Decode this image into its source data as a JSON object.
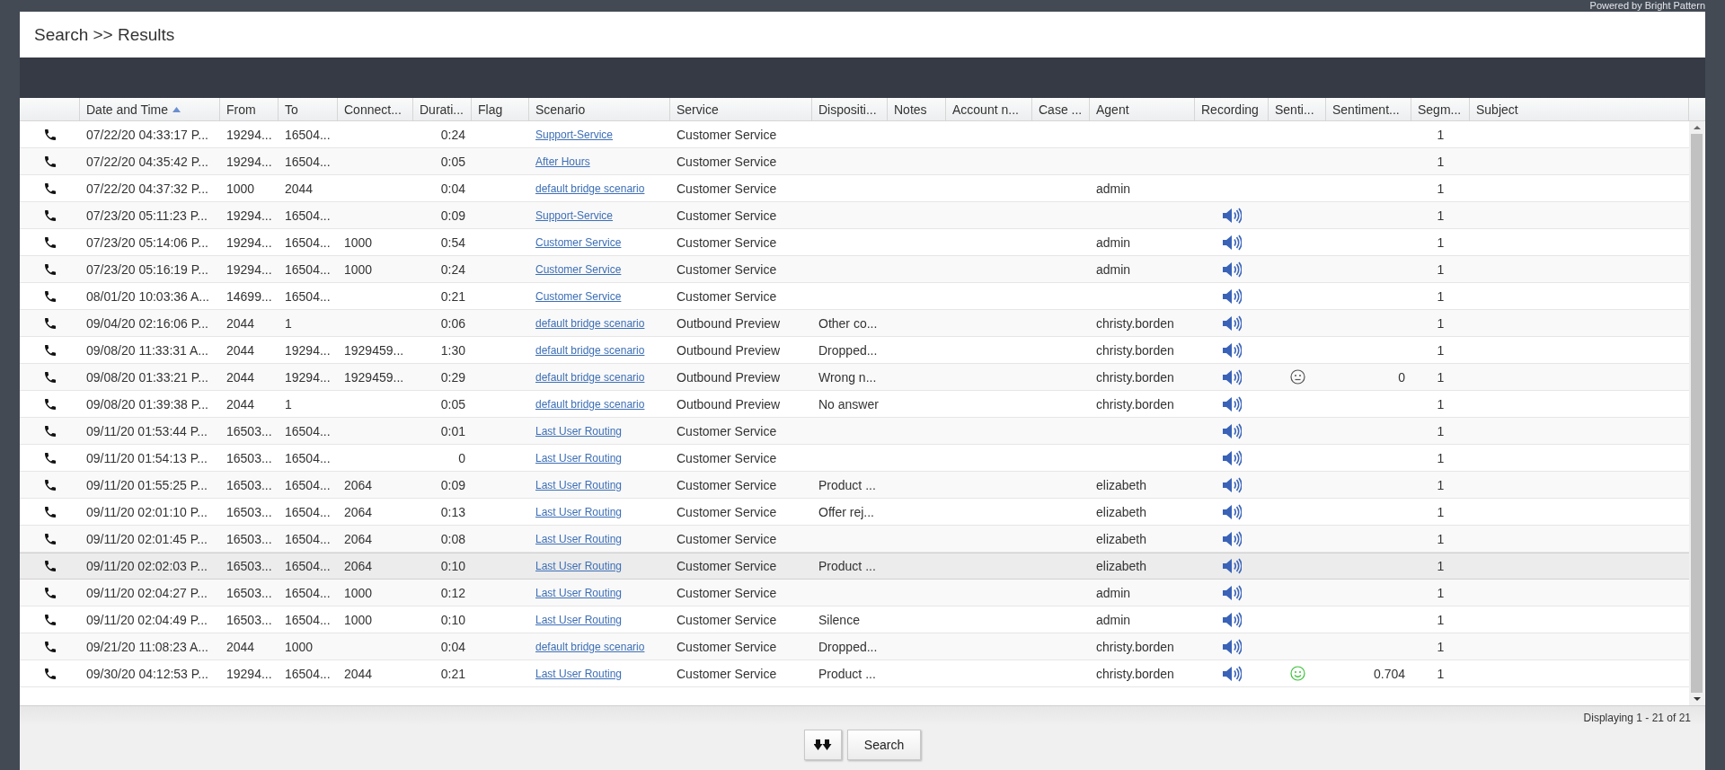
{
  "branding": "Powered by Bright Pattern",
  "page_title": "Search >> Results",
  "table": {
    "columns": [
      {
        "label": "Date and Time",
        "sorted_ascending": true
      },
      {
        "label": "From"
      },
      {
        "label": "To"
      },
      {
        "label": "Connect..."
      },
      {
        "label": "Durati..."
      },
      {
        "label": "Flag"
      },
      {
        "label": "Scenario"
      },
      {
        "label": "Service"
      },
      {
        "label": "Dispositi..."
      },
      {
        "label": "Notes"
      },
      {
        "label": "Account n..."
      },
      {
        "label": "Case ..."
      },
      {
        "label": "Agent"
      },
      {
        "label": "Recording"
      },
      {
        "label": "Senti..."
      },
      {
        "label": "Sentiment..."
      },
      {
        "label": "Segm..."
      },
      {
        "label": "Subject"
      }
    ],
    "rows": [
      {
        "date_and_time": "07/22/20 04:33:17 P...",
        "from": "19294...",
        "to": "16504...",
        "duration": "0:24",
        "scenario": "Support-Service",
        "service": "Customer Service",
        "segments": "1",
        "recording": false,
        "selected": false
      },
      {
        "date_and_time": "07/22/20 04:35:42 P...",
        "from": "19294...",
        "to": "16504...",
        "duration": "0:05",
        "scenario": "After Hours",
        "service": "Customer Service",
        "segments": "1",
        "recording": false,
        "selected": false
      },
      {
        "date_and_time": "07/22/20 04:37:32 P...",
        "from": "1000",
        "to": "2044",
        "duration": "0:04",
        "scenario": "default bridge scenario",
        "service": "Customer Service",
        "agent": "admin",
        "segments": "1",
        "recording": false,
        "selected": false
      },
      {
        "date_and_time": "07/23/20 05:11:23 P...",
        "from": "19294...",
        "to": "16504...",
        "duration": "0:09",
        "scenario": "Support-Service",
        "service": "Customer Service",
        "segments": "1",
        "recording": true,
        "selected": false
      },
      {
        "date_and_time": "07/23/20 05:14:06 P...",
        "from": "19294...",
        "to": "16504...",
        "connected": "1000",
        "duration": "0:54",
        "scenario": "Customer Service",
        "service": "Customer Service",
        "agent": "admin",
        "segments": "1",
        "recording": true,
        "selected": false
      },
      {
        "date_and_time": "07/23/20 05:16:19 P...",
        "from": "19294...",
        "to": "16504...",
        "connected": "1000",
        "duration": "0:24",
        "scenario": "Customer Service",
        "service": "Customer Service",
        "agent": "admin",
        "segments": "1",
        "recording": true,
        "selected": false
      },
      {
        "date_and_time": "08/01/20 10:03:36 A...",
        "from": "14699...",
        "to": "16504...",
        "duration": "0:21",
        "scenario": "Customer Service",
        "service": "Customer Service",
        "segments": "1",
        "recording": true,
        "selected": false
      },
      {
        "date_and_time": "09/04/20 02:16:06 P...",
        "from": "2044",
        "to": "1",
        "duration": "0:06",
        "scenario": "default bridge scenario",
        "service": "Outbound Preview",
        "disposition": "Other co...",
        "agent": "christy.borden",
        "segments": "1",
        "recording": true,
        "selected": false
      },
      {
        "date_and_time": "09/08/20 11:33:31 A...",
        "from": "2044",
        "to": "19294...",
        "connected": "1929459...",
        "duration": "1:30",
        "scenario": "default bridge scenario",
        "service": "Outbound Preview",
        "disposition": "Dropped...",
        "agent": "christy.borden",
        "segments": "1",
        "recording": true,
        "selected": false
      },
      {
        "date_and_time": "09/08/20 01:33:21 P...",
        "from": "2044",
        "to": "19294...",
        "connected": "1929459...",
        "duration": "0:29",
        "scenario": "default bridge scenario",
        "service": "Outbound Preview",
        "disposition": "Wrong n...",
        "agent": "christy.borden",
        "sentiment_positive": false,
        "sentiment": "0",
        "segments": "1",
        "recording": true,
        "selected": false
      },
      {
        "date_and_time": "09/08/20 01:39:38 P...",
        "from": "2044",
        "to": "1",
        "duration": "0:05",
        "scenario": "default bridge scenario",
        "service": "Outbound Preview",
        "disposition": "No answer",
        "agent": "christy.borden",
        "segments": "1",
        "recording": true,
        "selected": false
      },
      {
        "date_and_time": "09/11/20 01:53:44 P...",
        "from": "16503...",
        "to": "16504...",
        "duration": "0:01",
        "scenario": "Last User Routing",
        "service": "Customer Service",
        "segments": "1",
        "recording": true,
        "selected": false
      },
      {
        "date_and_time": "09/11/20 01:54:13 P...",
        "from": "16503...",
        "to": "16504...",
        "duration": "0",
        "scenario": "Last User Routing",
        "service": "Customer Service",
        "segments": "1",
        "recording": true,
        "selected": false
      },
      {
        "date_and_time": "09/11/20 01:55:25 P...",
        "from": "16503...",
        "to": "16504...",
        "connected": "2064",
        "duration": "0:09",
        "scenario": "Last User Routing",
        "service": "Customer Service",
        "disposition": "Product ...",
        "agent": "elizabeth",
        "segments": "1",
        "recording": true,
        "selected": false
      },
      {
        "date_and_time": "09/11/20 02:01:10 P...",
        "from": "16503...",
        "to": "16504...",
        "connected": "2064",
        "duration": "0:13",
        "scenario": "Last User Routing",
        "service": "Customer Service",
        "disposition": "Offer rej...",
        "agent": "elizabeth",
        "segments": "1",
        "recording": true,
        "selected": false
      },
      {
        "date_and_time": "09/11/20 02:01:45 P...",
        "from": "16503...",
        "to": "16504...",
        "connected": "2064",
        "duration": "0:08",
        "scenario": "Last User Routing",
        "service": "Customer Service",
        "agent": "elizabeth",
        "segments": "1",
        "recording": true,
        "selected": false
      },
      {
        "date_and_time": "09/11/20 02:02:03 P...",
        "from": "16503...",
        "to": "16504...",
        "connected": "2064",
        "duration": "0:10",
        "scenario": "Last User Routing",
        "service": "Customer Service",
        "disposition": "Product ...",
        "agent": "elizabeth",
        "segments": "1",
        "recording": true,
        "selected": true
      },
      {
        "date_and_time": "09/11/20 02:04:27 P...",
        "from": "16503...",
        "to": "16504...",
        "connected": "1000",
        "duration": "0:12",
        "scenario": "Last User Routing",
        "service": "Customer Service",
        "agent": "admin",
        "segments": "1",
        "recording": true,
        "selected": false
      },
      {
        "date_and_time": "09/11/20 02:04:49 P...",
        "from": "16503...",
        "to": "16504...",
        "connected": "1000",
        "duration": "0:10",
        "scenario": "Last User Routing",
        "service": "Customer Service",
        "disposition": "Silence",
        "agent": "admin",
        "segments": "1",
        "recording": true,
        "selected": false
      },
      {
        "date_and_time": "09/21/20 11:08:23 A...",
        "from": "2044",
        "to": "1000",
        "duration": "0:04",
        "scenario": "default bridge scenario",
        "service": "Customer Service",
        "disposition": "Dropped...",
        "agent": "christy.borden",
        "segments": "1",
        "recording": true,
        "selected": false
      },
      {
        "date_and_time": "09/30/20 04:12:53 P...",
        "from": "19294...",
        "to": "16504...",
        "connected": "2044",
        "duration": "0:21",
        "scenario": "Last User Routing",
        "service": "Customer Service",
        "disposition": "Product ...",
        "agent": "christy.borden",
        "sentiment_positive": true,
        "sentiment": "0.704",
        "segments": "1",
        "recording": true,
        "selected": false
      }
    ]
  },
  "footer": {
    "status": "Displaying 1 - 21 of 21",
    "search_button": "Search"
  }
}
